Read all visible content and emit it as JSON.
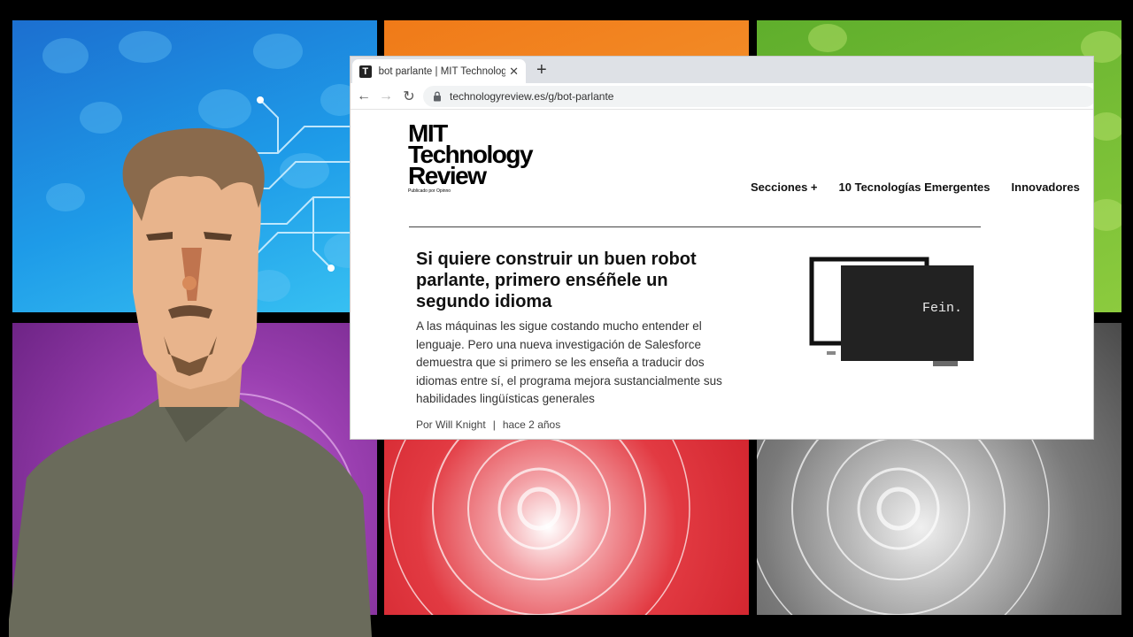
{
  "browser": {
    "tab": {
      "favicon_letter": "T",
      "title": "bot parlante | MIT Technology Re"
    },
    "new_tab_label": "+",
    "address_bar": {
      "url": "technologyreview.es/g/bot-parlante"
    }
  },
  "site": {
    "logo_lines": [
      "MIT",
      "Technology",
      "Review"
    ],
    "logo_tagline": "Publicado por Opinno",
    "nav": [
      {
        "label": "Secciones +"
      },
      {
        "label": "10 Tecnologías Emergentes"
      },
      {
        "label": "Innovadores"
      }
    ]
  },
  "article": {
    "headline": "Si quiere construir un buen robot parlante, primero enséñele un segundo idioma",
    "summary": "A las máquinas les sigue costando mucho entender el lenguaje. Pero una nueva investigación de Salesforce demuestra que si primero se les enseña a traducir dos idiomas entre sí, el programa mejora sustancialmente sus habilidades lingüísticas generales",
    "author": "Por Will Knight",
    "separator": "|",
    "date": "hace 2 años",
    "image_screen_text": "Fein."
  },
  "colors": {
    "tile_blue": "#1e9be8",
    "tile_orange": "#f7a23a",
    "tile_green": "#8ccb3e",
    "tile_purple": "#9a3fb0",
    "tile_red": "#e23a42",
    "tile_grey": "#7a7a7a"
  }
}
